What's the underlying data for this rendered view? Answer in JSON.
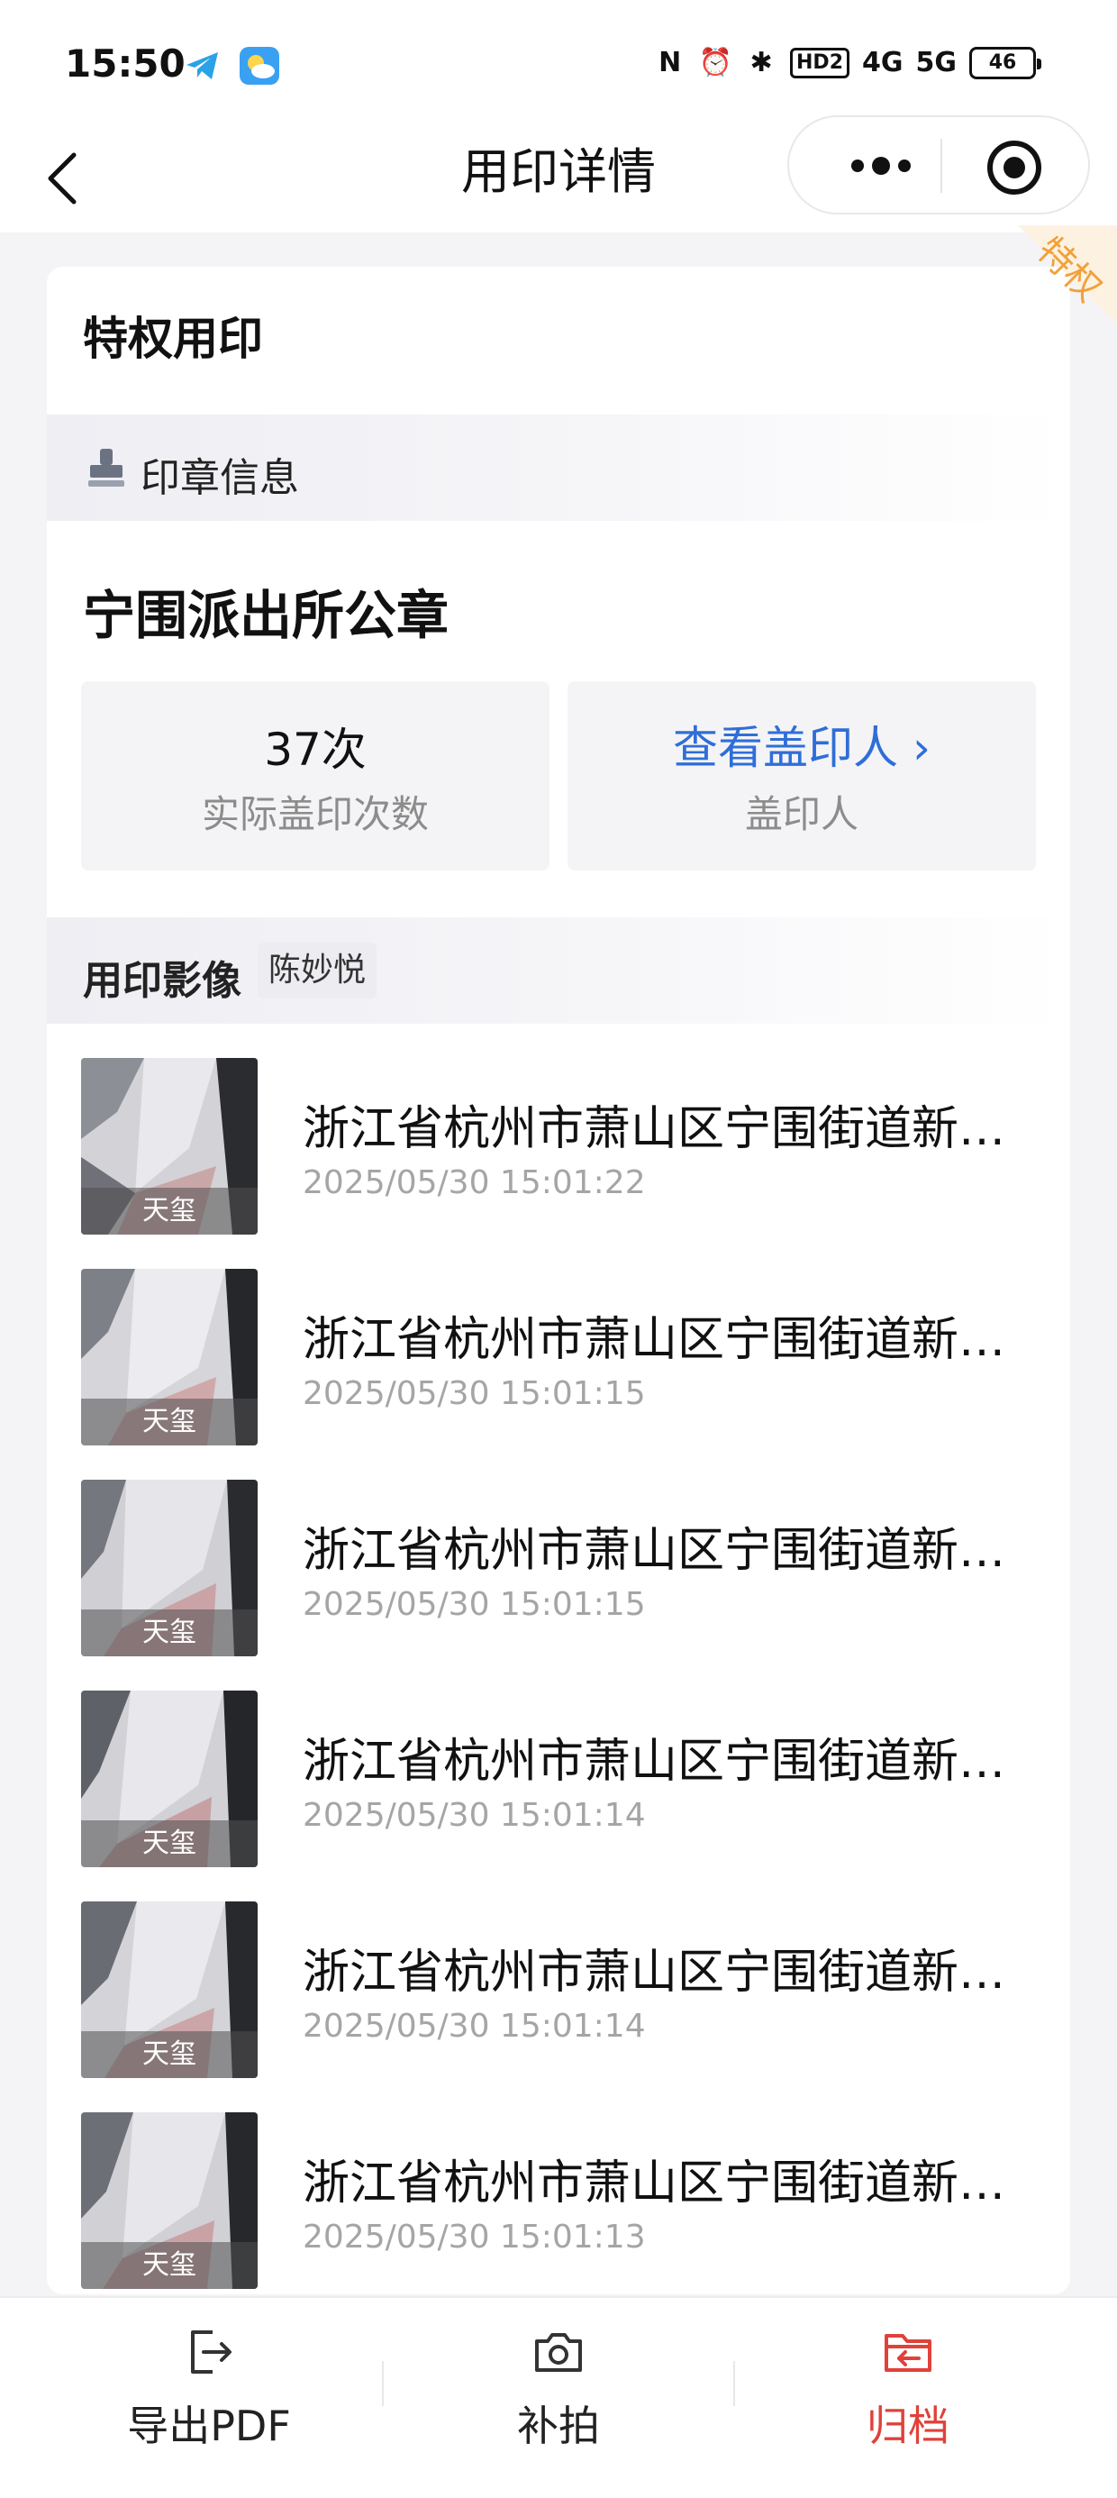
{
  "status_bar": {
    "time": "15:50",
    "right_glyphs": [
      "N",
      "⏰",
      "✱",
      "HD2",
      "4G",
      "5G"
    ],
    "battery": "46"
  },
  "nav": {
    "title": "用印详情",
    "icons": [
      "back-arrow-icon",
      "more-dots-icon",
      "close-target-icon"
    ]
  },
  "card": {
    "title": "特权用印",
    "badge": "特权",
    "seal_section_label": "印章信息",
    "seal_name": "宁围派出所公章",
    "stats": {
      "count_value": "37次",
      "count_caption": "实际盖印次数",
      "stamper_link": "查看盖印人 ›",
      "stamper_caption": "盖印人"
    },
    "image_section_label": "用印影像",
    "image_section_person": "陈妙悦",
    "records": [
      {
        "thumb_label": "天玺",
        "address": "浙江省杭州市萧山区宁围街道新…",
        "time": "2025/05/30 15:01:22"
      },
      {
        "thumb_label": "天玺",
        "address": "浙江省杭州市萧山区宁围街道新…",
        "time": "2025/05/30 15:01:15"
      },
      {
        "thumb_label": "天玺",
        "address": "浙江省杭州市萧山区宁围街道新…",
        "time": "2025/05/30 15:01:15"
      },
      {
        "thumb_label": "天玺",
        "address": "浙江省杭州市萧山区宁围街道新…",
        "time": "2025/05/30 15:01:14"
      },
      {
        "thumb_label": "天玺",
        "address": "浙江省杭州市萧山区宁围街道新…",
        "time": "2025/05/30 15:01:14"
      },
      {
        "thumb_label": "天玺",
        "address": "浙江省杭州市萧山区宁围街道新…",
        "time": "2025/05/30 15:01:13"
      }
    ]
  },
  "bottom_bar": {
    "export_label": "导出PDF",
    "retake_label": "补拍",
    "archive_label": "归档"
  },
  "colors": {
    "link_blue": "#2f6ed8",
    "archive_red": "#e0413a",
    "badge_orange": "#f0a23a"
  }
}
